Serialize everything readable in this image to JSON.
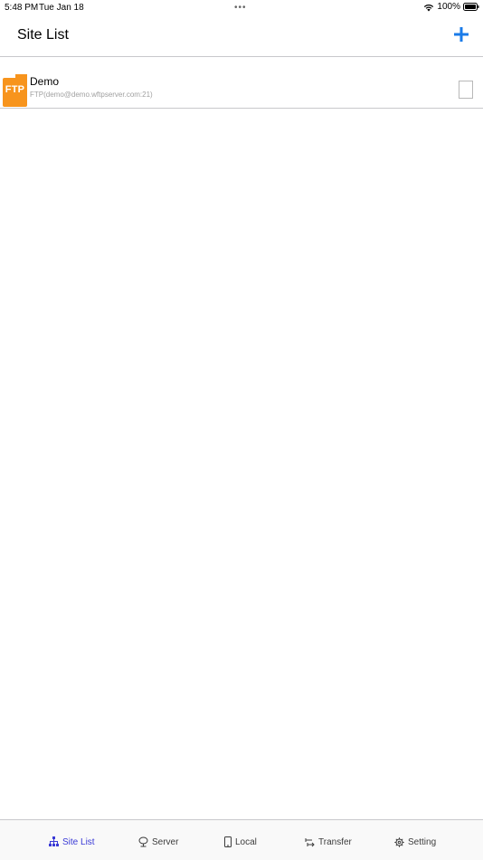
{
  "status_bar": {
    "time": "5:48 PM",
    "date": "Tue Jan 18",
    "battery": "100%"
  },
  "nav": {
    "title": "Site List",
    "add_icon": "plus-icon"
  },
  "sites": [
    {
      "icon_label": "FTP",
      "name": "Demo",
      "detail": "FTP(demo@demo.wftpserver.com:21)",
      "checked": false
    }
  ],
  "tabs": [
    {
      "label": "Site List",
      "icon": "site-list-icon",
      "active": true
    },
    {
      "label": "Server",
      "icon": "server-icon",
      "active": false
    },
    {
      "label": "Local",
      "icon": "phone-icon",
      "active": false
    },
    {
      "label": "Transfer",
      "icon": "transfer-icon",
      "active": false
    },
    {
      "label": "Setting",
      "icon": "gear-icon",
      "active": false
    }
  ],
  "colors": {
    "accent": "#1a7be8",
    "ftp_icon": "#f7941d",
    "tab_active": "#3a3ad6"
  }
}
